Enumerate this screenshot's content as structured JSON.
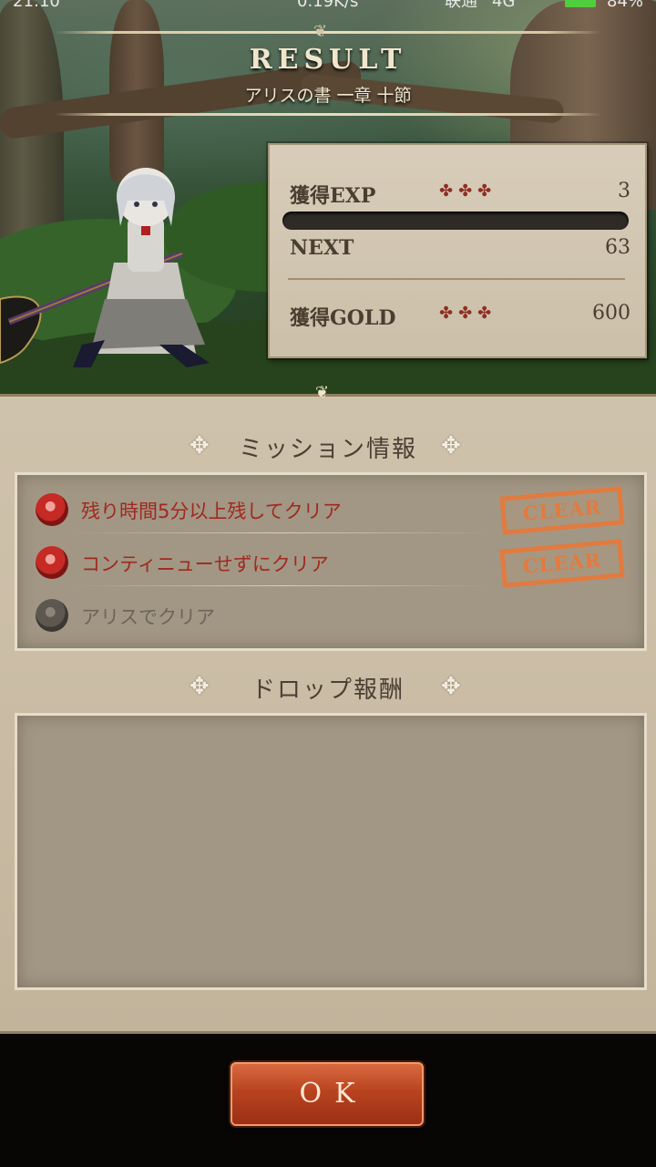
{
  "status_bar": {
    "time": "21:10",
    "net_speed": "0.19K/s",
    "carrier": "联通",
    "network": "4G",
    "battery": "84%"
  },
  "header": {
    "title": "RESULT",
    "subtitle": "アリスの書 一章 十節"
  },
  "stats": {
    "exp_label": "獲得EXP",
    "exp_value": "3",
    "exp_deco": "✤✤✤",
    "exp_progress": 0.0,
    "next_label": "NEXT",
    "next_value": "63",
    "gold_label": "獲得GOLD",
    "gold_value": "600",
    "gold_deco": "✤✤✤"
  },
  "missions": {
    "title": "ミッション情報",
    "items": [
      {
        "text": "残り時間5分以上残してクリア",
        "status": "CLEAR",
        "icon": "red-rose-icon"
      },
      {
        "text": "コンティニューせずにクリア",
        "status": "CLEAR",
        "icon": "red-rose-icon"
      },
      {
        "text": "アリスでクリア",
        "status": "",
        "icon": "grey-rose-icon"
      }
    ]
  },
  "drops": {
    "title": "ドロップ報酬"
  },
  "ok_button": {
    "label": "OK"
  },
  "colors": {
    "accent": "#b9431f",
    "clear_stamp": "#e37a3e",
    "mission_text": "#a0291f"
  }
}
